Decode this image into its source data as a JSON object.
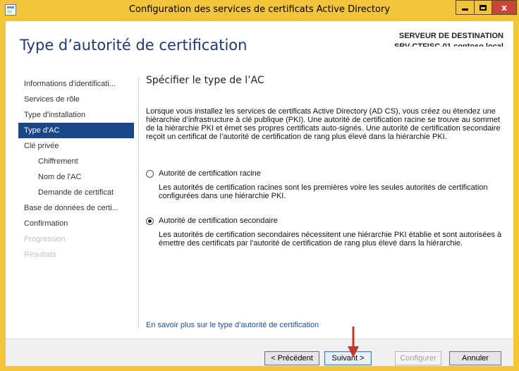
{
  "window": {
    "title": "Configuration des services de certificats Active Directory",
    "controls": [
      "minimize",
      "maximize",
      "close"
    ],
    "close_glyph": "x"
  },
  "header": {
    "page_title": "Type d’autorité de certification",
    "destination_label": "SERVEUR DE DESTINATION",
    "destination_server": "SRV-CTFISC-01.contoso.local"
  },
  "nav": {
    "items": [
      {
        "label": "Informations d'identificati...",
        "level": 0,
        "state": "normal"
      },
      {
        "label": "Services de rôle",
        "level": 0,
        "state": "normal"
      },
      {
        "label": "Type d'installation",
        "level": 0,
        "state": "normal"
      },
      {
        "label": "Type d'AC",
        "level": 0,
        "state": "active"
      },
      {
        "label": "Clé privée",
        "level": 0,
        "state": "normal"
      },
      {
        "label": "Chiffrement",
        "level": 1,
        "state": "normal"
      },
      {
        "label": "Nom de l'AC",
        "level": 1,
        "state": "normal"
      },
      {
        "label": "Demande de certificat",
        "level": 1,
        "state": "normal"
      },
      {
        "label": "Base de données de certi...",
        "level": 0,
        "state": "normal"
      },
      {
        "label": "Confirmation",
        "level": 0,
        "state": "normal"
      },
      {
        "label": "Progression",
        "level": 0,
        "state": "disabled"
      },
      {
        "label": "Résultats",
        "level": 0,
        "state": "disabled"
      }
    ]
  },
  "main": {
    "section_title": "Spécifier le type de l’AC",
    "description": "Lorsque vous installez les services de certificats Active Directory (AD CS), vous créez ou étendez une hiérarchie d’infrastructure à clé publique (PKI). Une autorité de certification racine se trouve au sommet de la hiérarchie PKI et émet ses propres certificats auto-signés. Une autorité de certification secondaire reçoit un certificat de l’autorité de certification de rang plus élevé dans la hiérarchie PKI.",
    "options": [
      {
        "label": "Autorité de certification racine",
        "checked": false,
        "description": "Les autorités de certification racines sont les premières voire les seules autorités de certification configurées dans une hiérarchie PKI."
      },
      {
        "label": "Autorité de certification secondaire",
        "checked": true,
        "description": "Les autorités de certification secondaires nécessitent une hiérarchie PKI établie et sont autorisées à émettre des certificats par l’autorité de certification de rang plus élevé dans la hiérarchie."
      }
    ],
    "help_link": "En savoir plus sur le type d’autorité de certification"
  },
  "footer": {
    "previous": "< Précédent",
    "next": "Suivant >",
    "configure": "Configurer",
    "cancel": "Annuler"
  },
  "colors": {
    "titlebar": "#f2c43b",
    "close_button": "#c7453a",
    "nav_active": "#19478a",
    "page_title": "#1e3a6e",
    "link": "#1a4f9c",
    "annotation_arrow": "#c0392b"
  }
}
